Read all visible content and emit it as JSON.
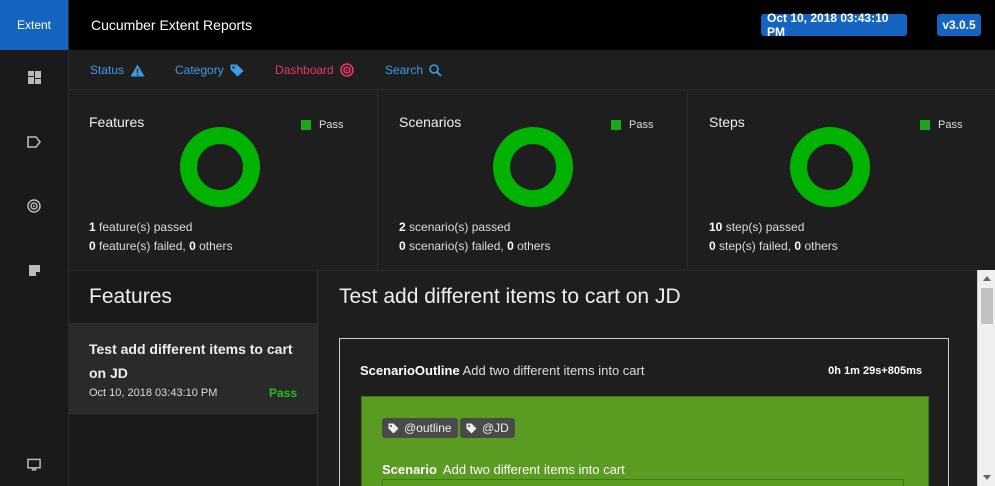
{
  "sidebar": {
    "brand": "Extent",
    "items": [
      {
        "icon": "dashboard-grid-icon"
      },
      {
        "icon": "tag-icon"
      },
      {
        "icon": "target-icon"
      },
      {
        "icon": "document-icon"
      }
    ],
    "footer_icon": "monitor-icon"
  },
  "header": {
    "title": "Cucumber Extent Reports",
    "date": "Oct 10, 2018 03:43:10 PM",
    "version": "v3.0.5"
  },
  "nav": {
    "items": [
      {
        "label": "Status",
        "icon": "warning-icon",
        "color": "#3d9be9"
      },
      {
        "label": "Category",
        "icon": "tag-icon",
        "color": "#3d9be9"
      },
      {
        "label": "Dashboard",
        "icon": "target-icon",
        "color": "#e2386a"
      },
      {
        "label": "Search",
        "icon": "search-icon",
        "color": "#3d9be9"
      }
    ]
  },
  "cards": [
    {
      "title": "Features",
      "legend": "Pass",
      "passed_count": "1",
      "passed_text": "feature(s) passed",
      "failed_count": "0",
      "failed_text": "feature(s) failed,",
      "others_count": "0",
      "others_text": "others",
      "pass_fraction": 1.0
    },
    {
      "title": "Scenarios",
      "legend": "Pass",
      "passed_count": "2",
      "passed_text": "scenario(s) passed",
      "failed_count": "0",
      "failed_text": "scenario(s) failed,",
      "others_count": "0",
      "others_text": "others",
      "pass_fraction": 1.0
    },
    {
      "title": "Steps",
      "legend": "Pass",
      "passed_count": "10",
      "passed_text": "step(s) passed",
      "failed_count": "0",
      "failed_text": "step(s) failed,",
      "others_count": "0",
      "others_text": "others",
      "pass_fraction": 1.0
    }
  ],
  "features_panel": {
    "heading": "Features",
    "item": {
      "title": "Test add different items to cart on JD",
      "date": "Oct 10, 2018 03:43:10 PM",
      "status": "Pass"
    }
  },
  "detail": {
    "title": "Test add different items to cart on JD",
    "outline": {
      "keyword": "ScenarioOutline",
      "name": "Add two different items into cart",
      "duration": "0h 1m 29s+805ms",
      "tags": [
        "@outline",
        "@JD"
      ],
      "scenario_keyword": "Scenario",
      "scenario_name": "Add two different items into cart"
    }
  },
  "colors": {
    "accent": "#1565c0",
    "pass": "#00b300",
    "scenario_bg": "#5a9b21"
  }
}
